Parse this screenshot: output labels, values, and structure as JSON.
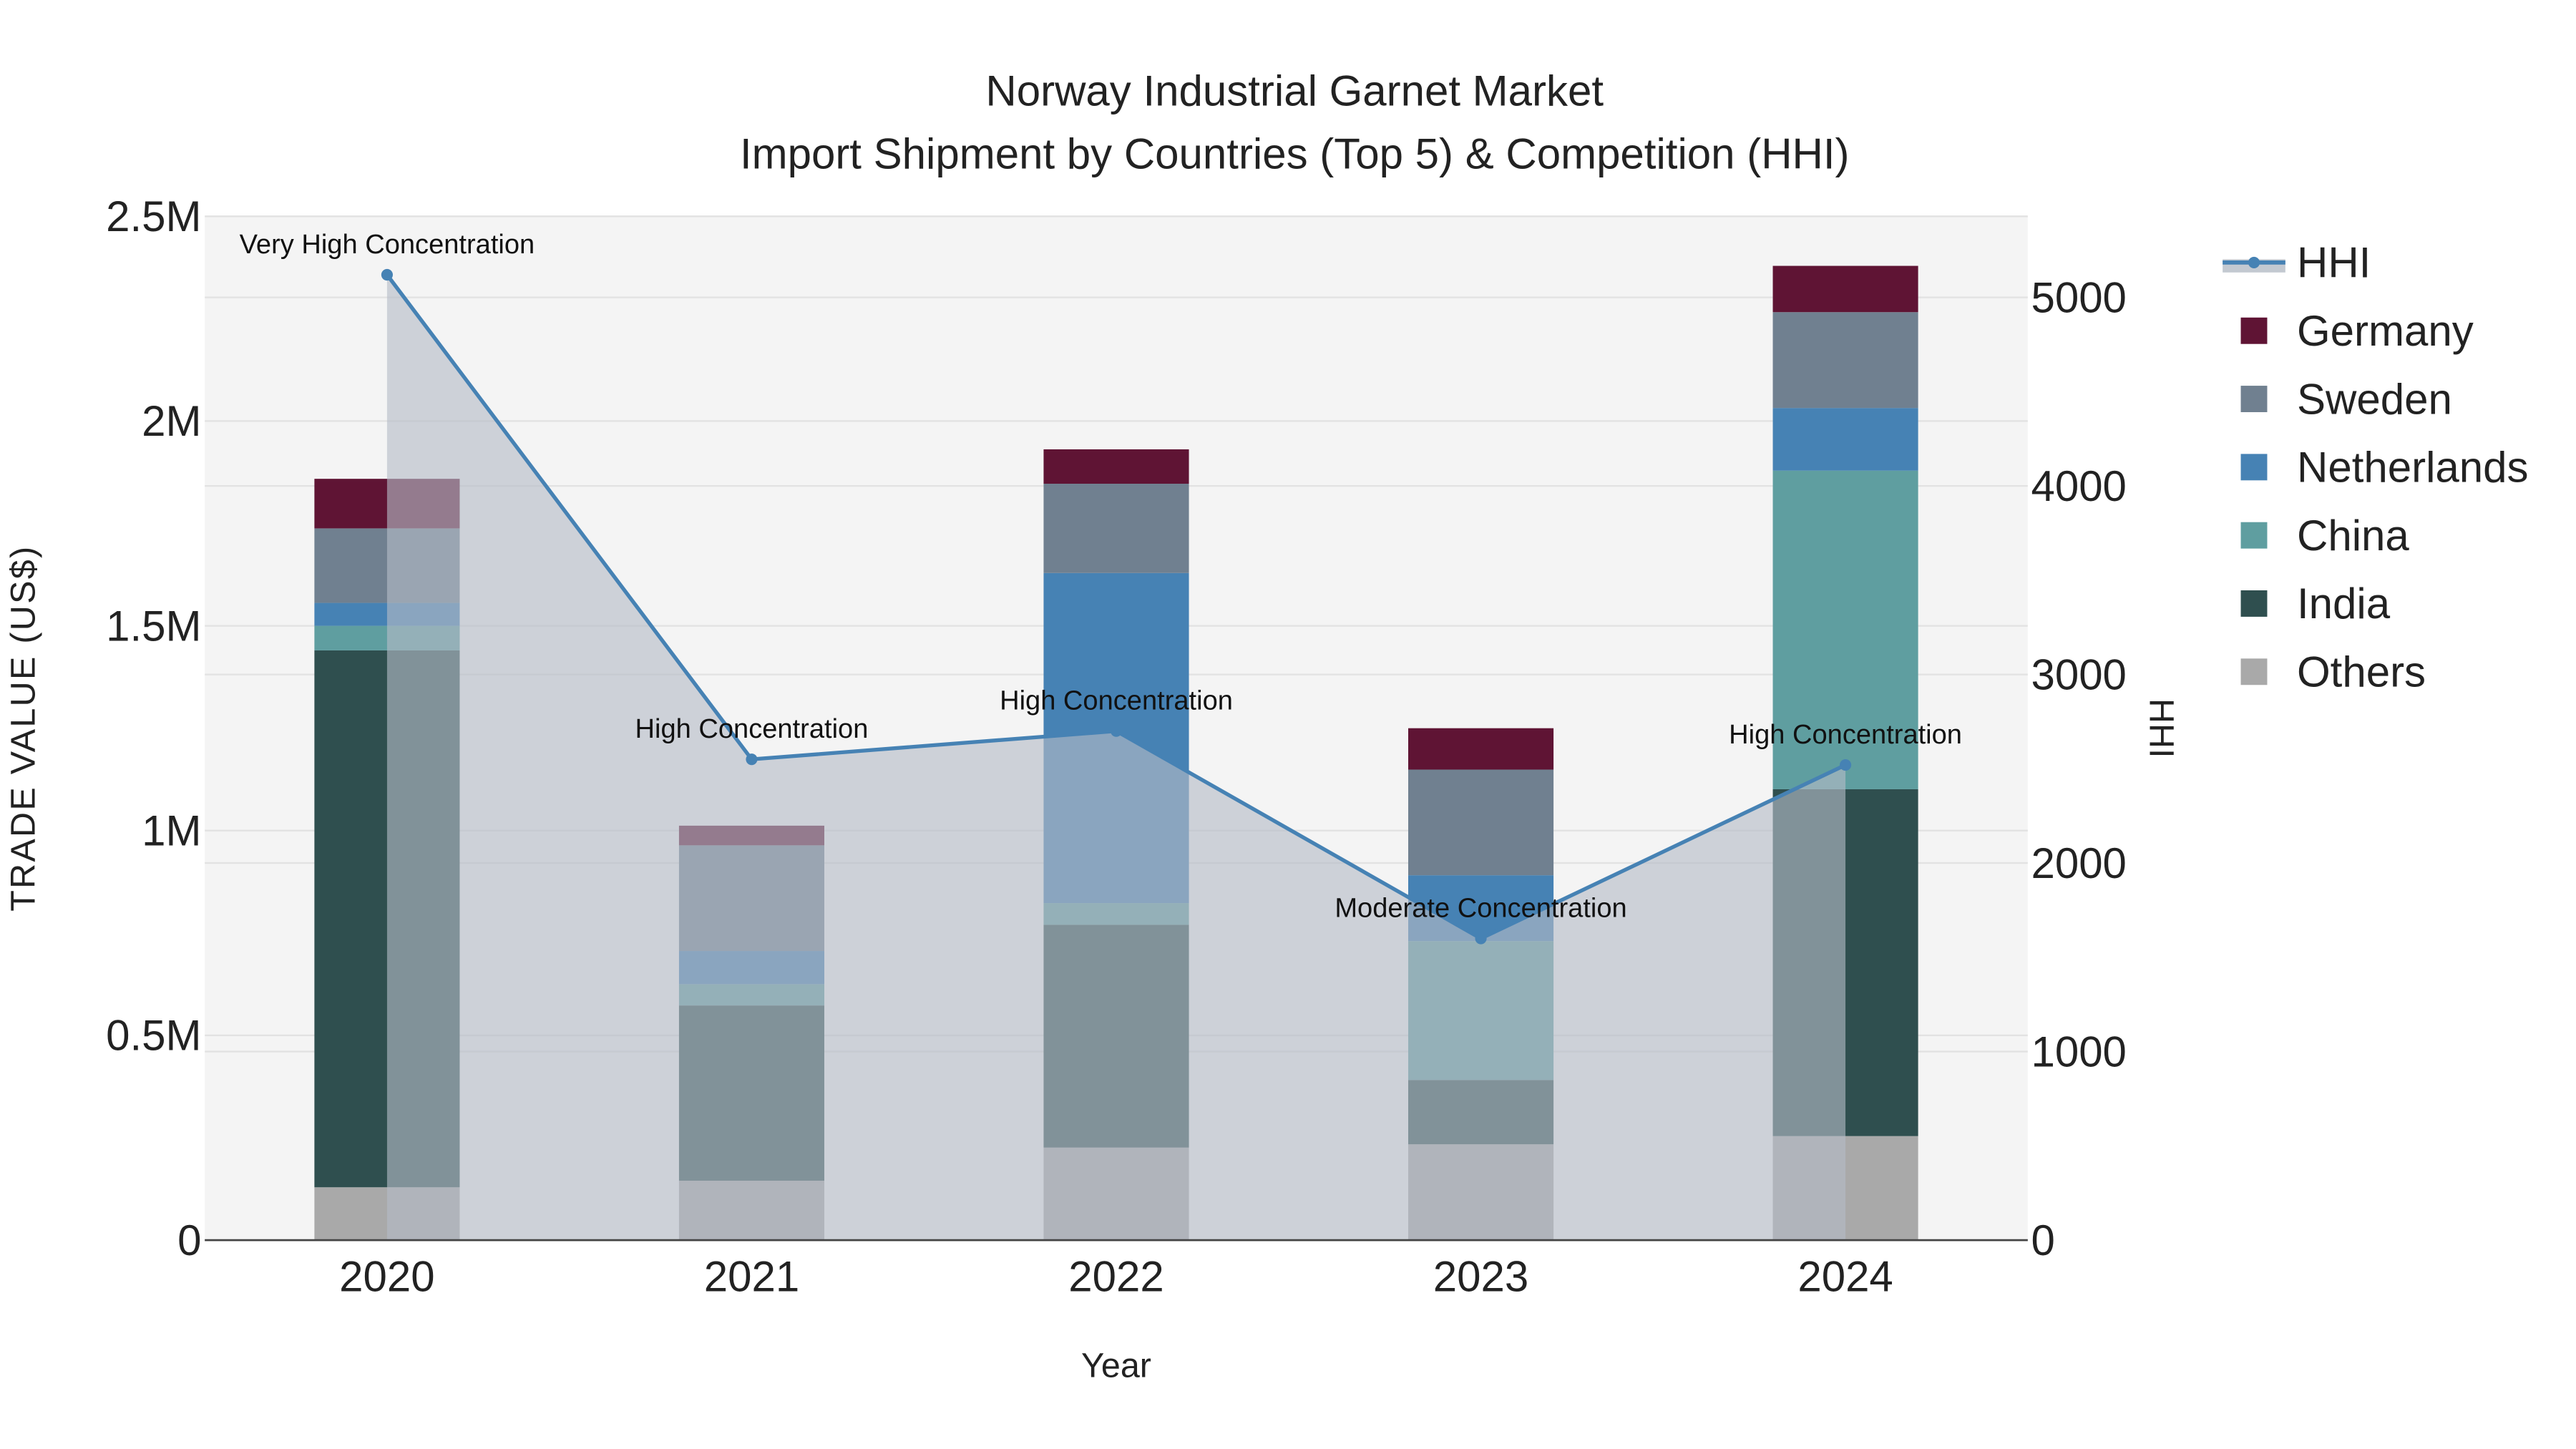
{
  "chart_data": {
    "type": "bar",
    "stacked": true,
    "title": "Norway Industrial Garnet Market",
    "subtitle": "Import Shipment by Countries (Top 5) & Competition (HHI)",
    "xlabel": "Year",
    "ylabel": "TRADE VALUE (US$)",
    "y2label": "HHI",
    "categories": [
      "2020",
      "2021",
      "2022",
      "2023",
      "2024"
    ],
    "ylim": [
      0,
      2500000
    ],
    "y2lim": [
      0,
      5430
    ],
    "yticks": [
      {
        "v": 0,
        "label": "0"
      },
      {
        "v": 500000,
        "label": "0.5M"
      },
      {
        "v": 1000000,
        "label": "1M"
      },
      {
        "v": 1500000,
        "label": "1.5M"
      },
      {
        "v": 2000000,
        "label": "2M"
      },
      {
        "v": 2500000,
        "label": "2.5M"
      }
    ],
    "y2ticks": [
      {
        "v": 0,
        "label": "0"
      },
      {
        "v": 1000,
        "label": "1000"
      },
      {
        "v": 2000,
        "label": "2000"
      },
      {
        "v": 3000,
        "label": "3000"
      },
      {
        "v": 4000,
        "label": "4000"
      },
      {
        "v": 5000,
        "label": "5000"
      }
    ],
    "series": [
      {
        "name": "Others",
        "color": "#a9a9a9",
        "values": [
          129000,
          145000,
          226000,
          234000,
          254000
        ]
      },
      {
        "name": "India",
        "color": "#2f4f4f",
        "values": [
          1311000,
          428000,
          544000,
          157000,
          847000
        ]
      },
      {
        "name": "China",
        "color": "#5f9ea0",
        "values": [
          60000,
          52000,
          53000,
          339000,
          778000
        ]
      },
      {
        "name": "Netherlands",
        "color": "#4682b4",
        "values": [
          56000,
          81000,
          806000,
          161000,
          153000
        ]
      },
      {
        "name": "Sweden",
        "color": "#708090",
        "values": [
          182000,
          258000,
          218000,
          258000,
          234000
        ]
      },
      {
        "name": "Germany",
        "color": "#5f1434",
        "values": [
          121000,
          48000,
          84000,
          101000,
          113000
        ]
      }
    ],
    "hhi": {
      "name": "HHI",
      "color": "#4682b4",
      "values": [
        5120,
        2550,
        2700,
        1600,
        2520
      ],
      "annotations": [
        "Very High Concentration",
        "High Concentration",
        "High Concentration",
        "Moderate Concentration",
        "High Concentration"
      ]
    },
    "legend": {
      "placement": "right",
      "order": [
        "HHI",
        "Germany",
        "Sweden",
        "Netherlands",
        "China",
        "India",
        "Others"
      ]
    },
    "grid": true
  }
}
